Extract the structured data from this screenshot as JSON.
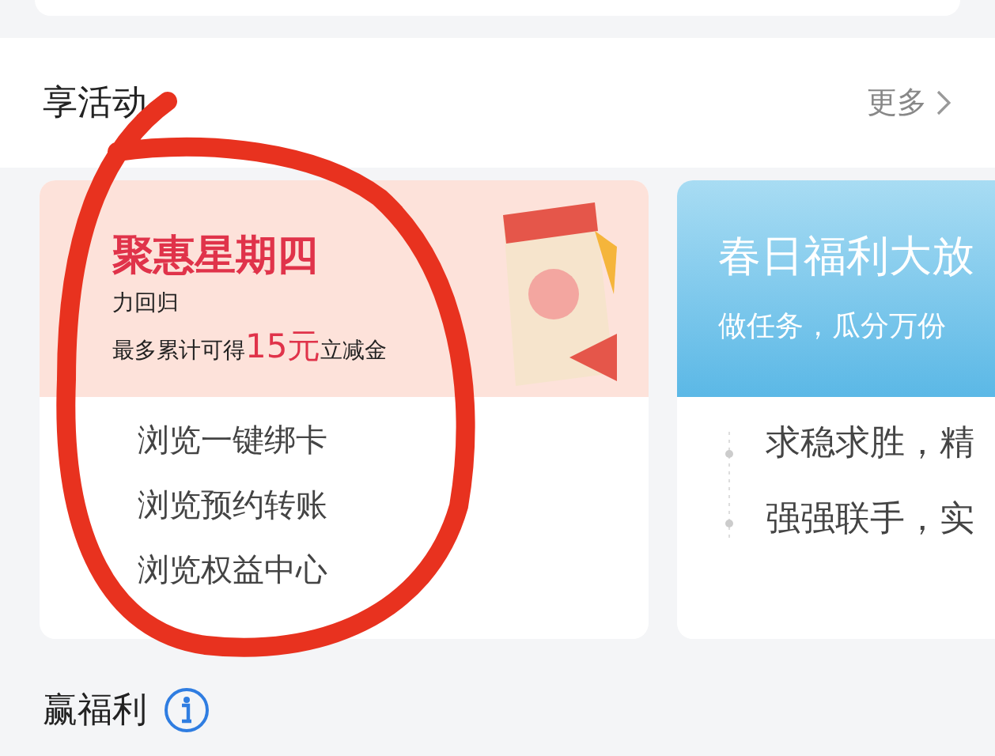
{
  "activities": {
    "title": "享活动",
    "more": "更多",
    "cards": [
      {
        "kind": "promo",
        "banner": {
          "title": "聚惠星期四",
          "lines": [
            "力回归",
            "最多累计可得**15元**立减金"
          ]
        },
        "items": [
          "浏览一键绑卡",
          "浏览预约转账",
          "浏览权益中心"
        ]
      },
      {
        "kind": "sky",
        "banner": {
          "title": "春日福利大放",
          "lines": [
            "做任务，瓜分万份"
          ]
        },
        "items": [
          "求稳求胜，精",
          "强强联手，实"
        ]
      }
    ]
  },
  "benefits": {
    "title": "赢福利"
  }
}
